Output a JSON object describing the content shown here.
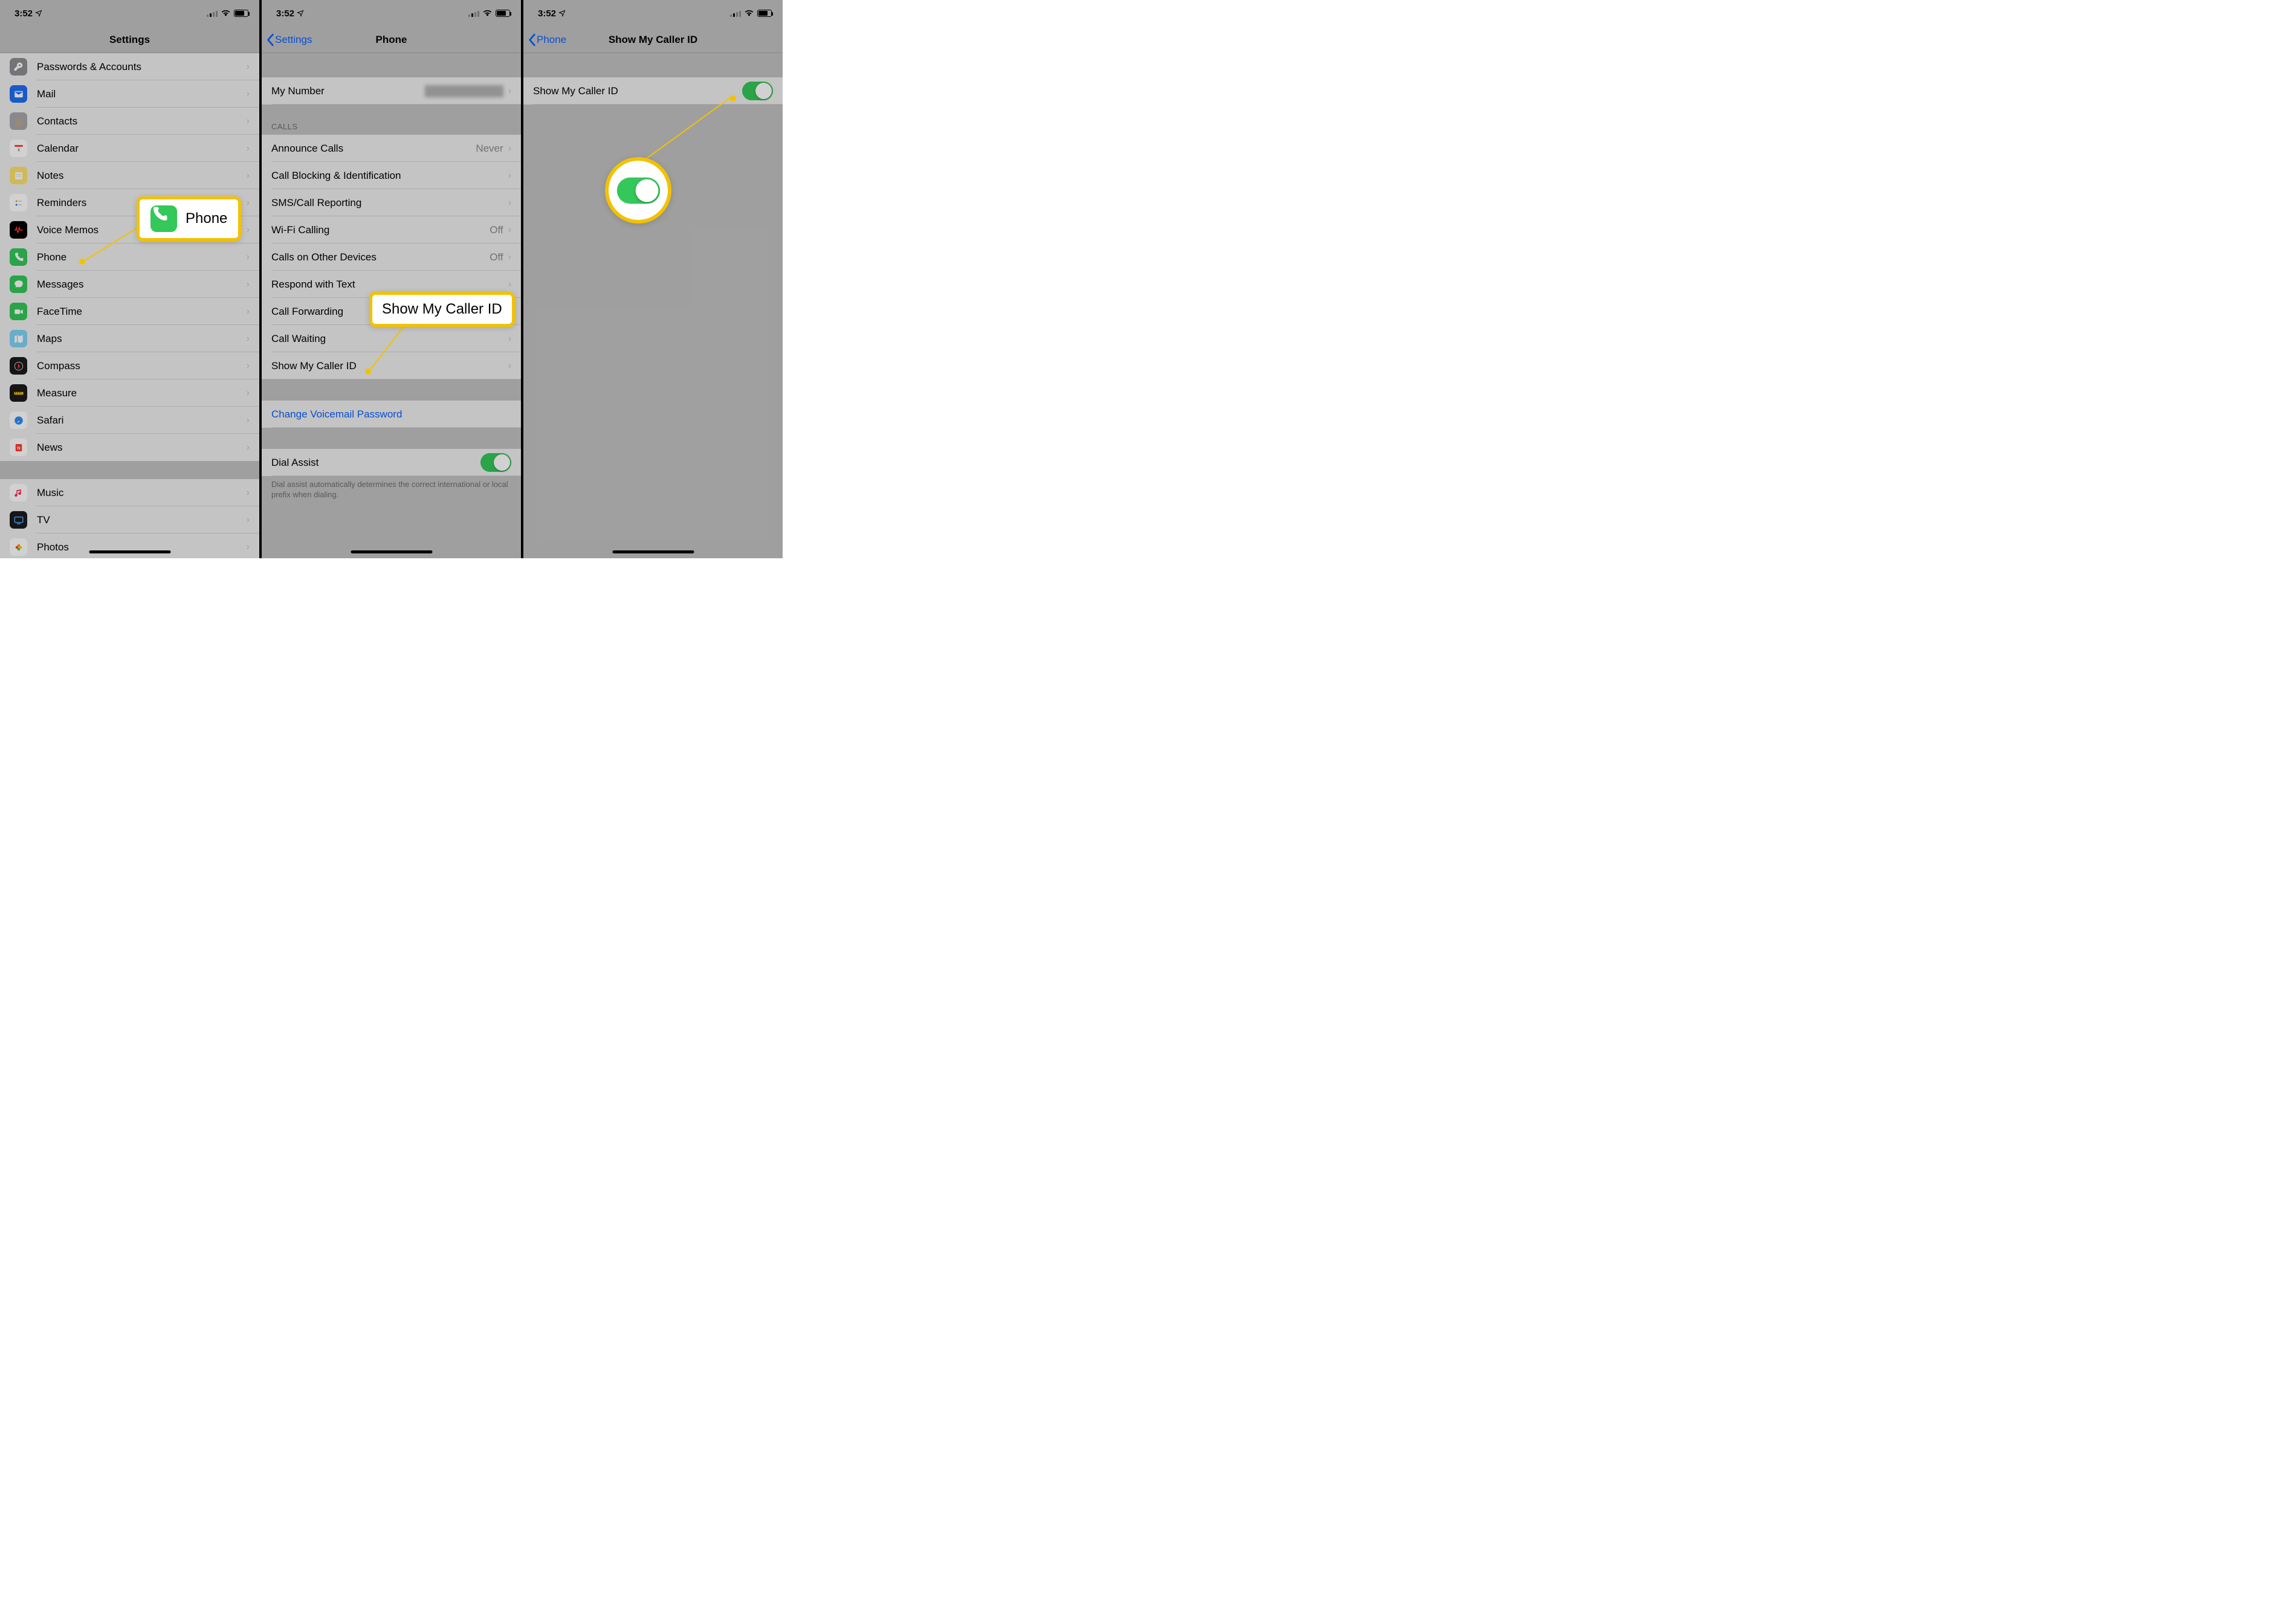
{
  "status": {
    "time": "3:52"
  },
  "screen1": {
    "title": "Settings",
    "items": [
      {
        "icon": "key",
        "bg": "#8e8e93",
        "label": "Passwords & Accounts"
      },
      {
        "icon": "mail",
        "bg": "#1f6ef6",
        "label": "Mail"
      },
      {
        "icon": "contacts",
        "bg": "#a8a8ad",
        "label": "Contacts"
      },
      {
        "icon": "calendar",
        "bg": "#ffffff",
        "label": "Calendar"
      },
      {
        "icon": "notes",
        "bg": "#ffe26b",
        "label": "Notes"
      },
      {
        "icon": "reminders",
        "bg": "#ffffff",
        "label": "Reminders"
      },
      {
        "icon": "voicememo",
        "bg": "#000000",
        "label": "Voice Memos"
      },
      {
        "icon": "phone",
        "bg": "#34c759",
        "label": "Phone"
      },
      {
        "icon": "messages",
        "bg": "#34c759",
        "label": "Messages"
      },
      {
        "icon": "facetime",
        "bg": "#34c759",
        "label": "FaceTime"
      },
      {
        "icon": "maps",
        "bg": "#7fd3f7",
        "label": "Maps"
      },
      {
        "icon": "compass",
        "bg": "#1c1c1e",
        "label": "Compass"
      },
      {
        "icon": "measure",
        "bg": "#1c1c1e",
        "label": "Measure"
      },
      {
        "icon": "safari",
        "bg": "#ffffff",
        "label": "Safari"
      },
      {
        "icon": "news",
        "bg": "#ffffff",
        "label": "News"
      }
    ],
    "group2": [
      {
        "icon": "music",
        "bg": "#ffffff",
        "label": "Music"
      },
      {
        "icon": "tv",
        "bg": "#1c1c1e",
        "label": "TV"
      },
      {
        "icon": "photos",
        "bg": "#ffffff",
        "label": "Photos"
      }
    ],
    "callout_label": "Phone"
  },
  "screen2": {
    "back": "Settings",
    "title": "Phone",
    "my_number_label": "My Number",
    "calls_header": "CALLS",
    "calls_items": [
      {
        "label": "Announce Calls",
        "value": "Never"
      },
      {
        "label": "Call Blocking & Identification",
        "value": ""
      },
      {
        "label": "SMS/Call Reporting",
        "value": ""
      },
      {
        "label": "Wi-Fi Calling",
        "value": "Off"
      },
      {
        "label": "Calls on Other Devices",
        "value": "Off"
      },
      {
        "label": "Respond with Text",
        "value": ""
      },
      {
        "label": "Call Forwarding",
        "value": ""
      },
      {
        "label": "Call Waiting",
        "value": ""
      },
      {
        "label": "Show My Caller ID",
        "value": ""
      }
    ],
    "voicemail_link": "Change Voicemail Password",
    "dial_assist_label": "Dial Assist",
    "dial_assist_footer": "Dial assist automatically determines the correct international or local prefix when dialing.",
    "callout_label": "Show My Caller ID"
  },
  "screen3": {
    "back": "Phone",
    "title": "Show My Caller ID",
    "toggle_label": "Show My Caller ID",
    "toggle_on": true
  }
}
